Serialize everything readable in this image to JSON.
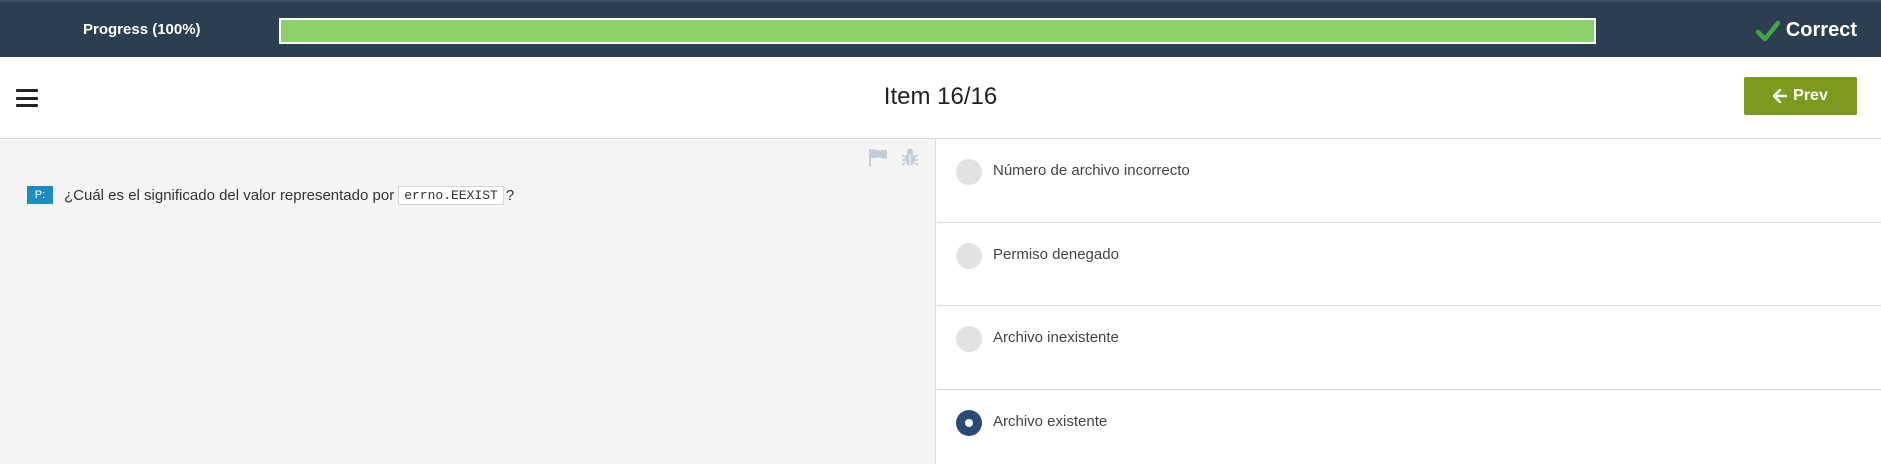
{
  "progress": {
    "label": "Progress (100%)",
    "percent": 100,
    "fill_color": "#8ed16a"
  },
  "result": {
    "label": "Correct",
    "icon": "check-icon"
  },
  "header": {
    "menu_icon": "hamburger-menu-icon",
    "title": "Item 16/16",
    "prev_label": "Prev",
    "prev_icon": "arrow-left-icon",
    "prev_color": "#7b9a1e"
  },
  "question": {
    "badge": "P:",
    "text_before": "¿Cuál es el significado del valor representado por",
    "code": "errno.EEXIST",
    "text_after": "?",
    "tools": [
      "flag-icon",
      "bug-icon"
    ]
  },
  "options": [
    {
      "label": "Número de archivo incorrecto",
      "selected": false
    },
    {
      "label": "Permiso denegado",
      "selected": false
    },
    {
      "label": "Archivo inexistente",
      "selected": false
    },
    {
      "label": "Archivo existente",
      "selected": true
    }
  ]
}
